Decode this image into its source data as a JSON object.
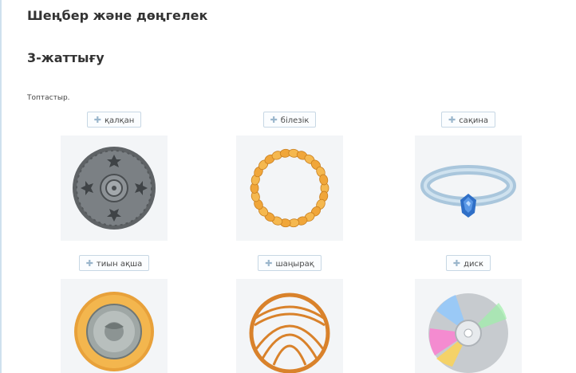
{
  "lesson": {
    "title": "Шеңбер және дөңгелек"
  },
  "exercise": {
    "title": "3-жаттығу",
    "instruction": "Топтастыр."
  },
  "icons": {
    "drag": "plus-drag-icon"
  },
  "cards": [
    {
      "label": "қалқан",
      "picture": "shield-picture"
    },
    {
      "label": "білезік",
      "picture": "bracelet-picture"
    },
    {
      "label": "сақина",
      "picture": "ring-picture"
    },
    {
      "label": "тиын ақша",
      "picture": "coin-picture"
    },
    {
      "label": "шаңырақ",
      "picture": "shanyrak-picture"
    },
    {
      "label": "диск",
      "picture": "disc-picture"
    }
  ]
}
